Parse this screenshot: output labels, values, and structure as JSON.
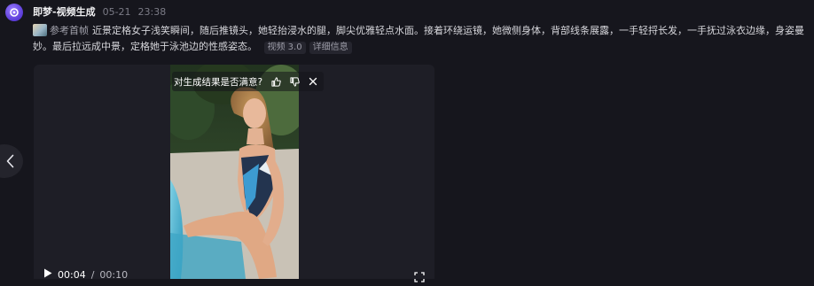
{
  "header": {
    "app_name": "即梦-视频生成",
    "date": "05-21",
    "time": "23:38"
  },
  "prompt": {
    "reference_label": "参考首帧",
    "text": "近景定格女子浅笑瞬间，随后推镜头，她轻抬浸水的腿，脚尖优雅轻点水面。接着环绕运镜，她微侧身体，背部线条展露，一手轻捋长发，一手抚过泳衣边缘，身姿曼妙。最后拉远成中景，定格她于泳池边的性感姿态。",
    "model_chip": "视频 3.0",
    "details_chip": "详细信息"
  },
  "feedback": {
    "question": "对生成结果是否满意?",
    "like_icon": "thumbs-up-icon",
    "dislike_icon": "thumbs-down-icon",
    "close_icon": "close-icon"
  },
  "player": {
    "current_time": "00:04",
    "separator": "/",
    "total_time": "00:10",
    "progress": 0.4
  },
  "colors": {
    "background": "#16161d",
    "player_bg": "#1e1e26",
    "avatar_accent": "#6b4cf0",
    "muted_text": "#7b7b86"
  }
}
